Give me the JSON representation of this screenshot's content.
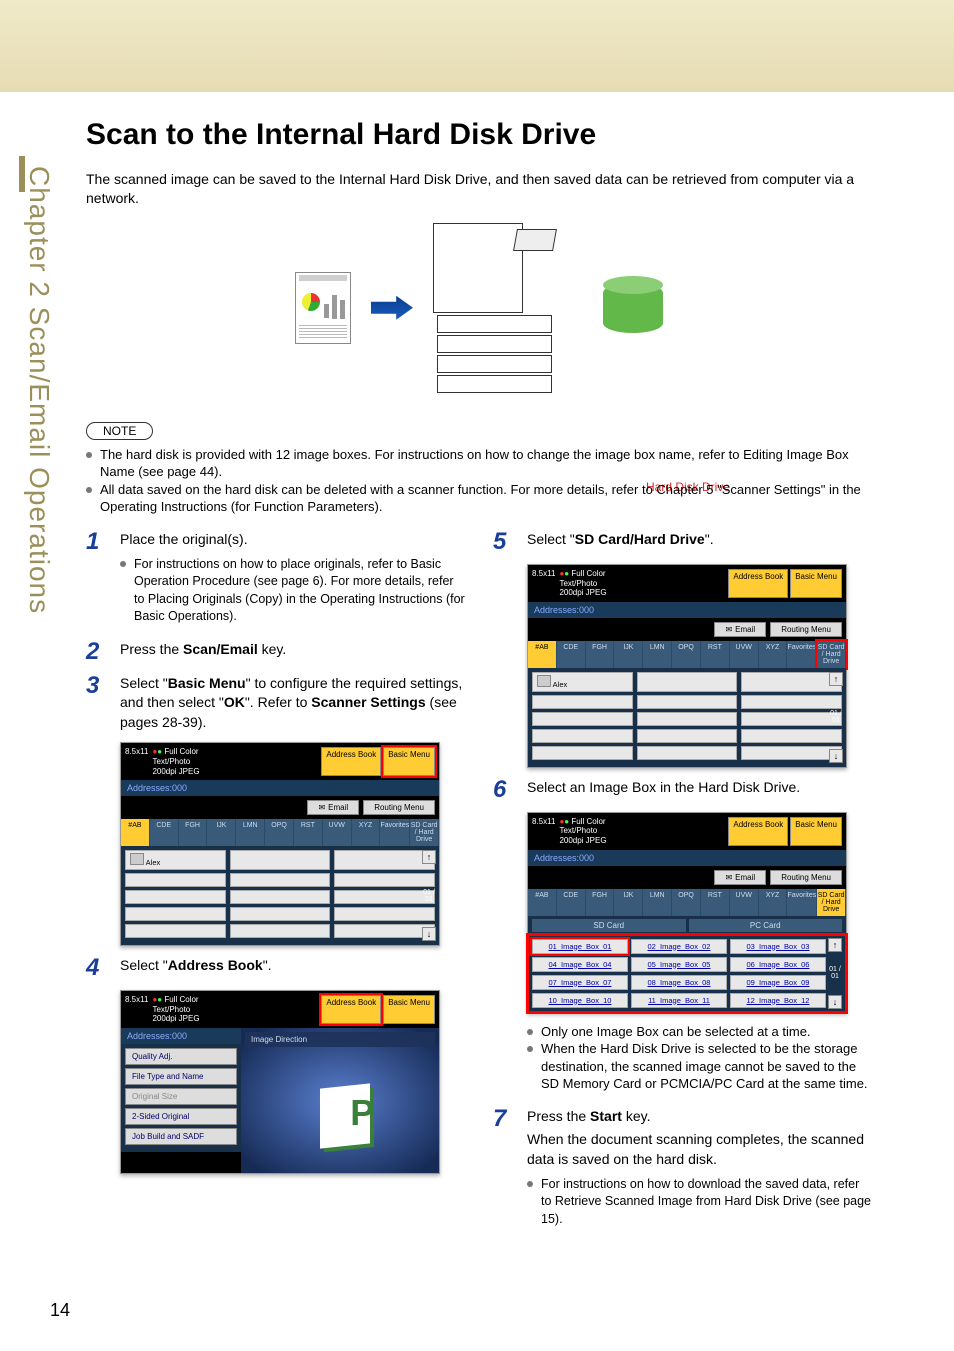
{
  "sidebar_label": "Chapter 2  Scan/Email Operations",
  "page_number": "14",
  "title": "Scan to the Internal Hard Disk Drive",
  "intro": "The scanned image can be saved to the Internal Hard Disk Drive, and then saved data can be retrieved from computer via a network.",
  "diagram": {
    "hdd_label": "Hard Disk Drive"
  },
  "note_badge": "NOTE",
  "notes": [
    "The hard disk is provided with 12 image boxes. For instructions on how to change the image box name, refer to Editing Image Box Name (see page 44).",
    "All data saved on the hard disk can be deleted with a scanner function. For more details, refer to Chapter 5 \"Scanner Settings\" in the Operating Instructions (for Function Parameters)."
  ],
  "steps": {
    "s1": {
      "text": "Place the original(s).",
      "sub": "For instructions on how to place originals, refer to Basic Operation Procedure (see page 6). For more details, refer to Placing Originals (Copy) in the Operating Instructions (for Basic Operations)."
    },
    "s2": {
      "text_pre": "Press the ",
      "bold": "Scan/Email",
      "text_post": " key."
    },
    "s3": {
      "text": "Select \"Basic Menu\" to configure the required settings, and then select \"OK\". Refer to Scanner Settings (see pages 28-39)."
    },
    "s4": {
      "text_pre": "Select \"",
      "bold": "Address Book",
      "text_post": "\"."
    },
    "s5": {
      "text_pre": "Select \"",
      "bold": "SD Card/Hard Drive",
      "text_post": "\"."
    },
    "s6": {
      "text": "Select an Image Box in the Hard Disk Drive."
    },
    "s6_subs": [
      "Only one Image Box can be selected at a time.",
      "When the Hard Disk Drive is selected to be the storage destination, the scanned image cannot be saved to the SD Memory Card or PCMCIA/PC Card at the same time."
    ],
    "s7": {
      "text_pre": "Press the ",
      "bold": "Start",
      "text_post": " key.",
      "body": "When the document scanning completes, the scanned data is saved on the hard disk.",
      "sub": "For instructions on how to download the saved data, refer to Retrieve Scanned Image from Hard Disk Drive (see page 15)."
    }
  },
  "screen": {
    "paper_size": "8.5x11",
    "color_mode": "Full Color",
    "doc_type": "Text/Photo",
    "resolution": "200dpi JPEG",
    "addresses": "Addresses:000",
    "btn_address_book": "Address Book",
    "btn_basic_menu": "Basic Menu",
    "btn_email": "Email",
    "btn_routing_menu": "Routing Menu",
    "tabs": [
      "#AB",
      "CDE",
      "FGH",
      "IJK",
      "LMN",
      "OPQ",
      "RST",
      "UVW",
      "XYZ",
      "Favorites",
      "SD Card / Hard Drive"
    ],
    "list_alex": "Alex",
    "scroll": "01 / 01",
    "img_direction": "Image Direction",
    "menu_items": [
      "Quality Adj.",
      "File Type and Name",
      "Original Size",
      "2-Sided Original",
      "Job Build and SADF"
    ],
    "ib_headers": [
      "SD Card",
      "PC Card"
    ],
    "image_boxes": [
      "01_Image_Box_01",
      "02_Image_Box_02",
      "03_Image_Box_03",
      "04_Image_Box_04",
      "05_Image_Box_05",
      "06_Image_Box_06",
      "07_Image_Box_07",
      "08_Image_Box_08",
      "09_Image_Box_09",
      "10_Image_Box_10",
      "11_Image_Box_11",
      "12_Image_Box_12"
    ]
  }
}
